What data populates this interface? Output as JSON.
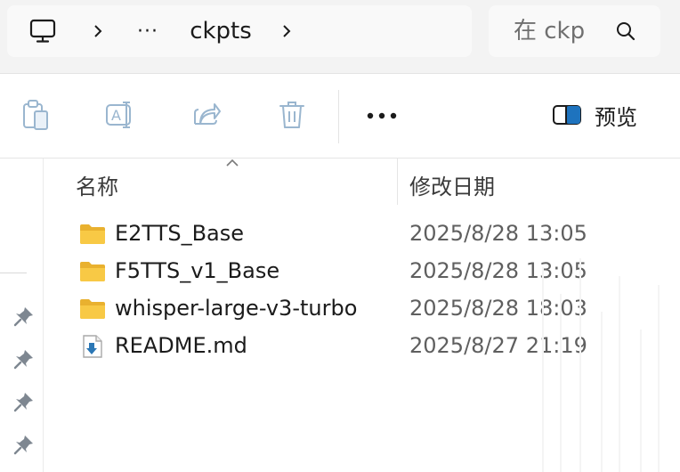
{
  "address_bar": {
    "path": [
      {
        "type": "icon",
        "name": "computer"
      },
      {
        "type": "separator",
        "label": ">"
      },
      {
        "type": "overflow",
        "label": "···"
      },
      {
        "type": "folder",
        "label": "ckpts"
      },
      {
        "type": "separator",
        "label": ">"
      }
    ]
  },
  "search": {
    "placeholder": "在 ckp",
    "icon": "search-icon"
  },
  "toolbar": {
    "buttons": [
      {
        "name": "paste",
        "icon": "clipboard-icon"
      },
      {
        "name": "rename",
        "icon": "rename-icon"
      },
      {
        "name": "share",
        "icon": "share-icon"
      },
      {
        "name": "delete",
        "icon": "trash-icon"
      }
    ],
    "more_label": "•••",
    "preview_label": "预览"
  },
  "columns": {
    "name": "名称",
    "modified": "修改日期"
  },
  "files": [
    {
      "name": "E2TTS_Base",
      "date": "2025/8/28 13:05",
      "type": "folder"
    },
    {
      "name": "F5TTS_v1_Base",
      "date": "2025/8/28 13:05",
      "type": "folder"
    },
    {
      "name": "whisper-large-v3-turbo",
      "date": "2025/8/28 18:03",
      "type": "folder"
    },
    {
      "name": "README.md",
      "date": "2025/8/27 21:19",
      "type": "file"
    }
  ],
  "colors": {
    "folder_yellow": "#f8c945",
    "folder_dark": "#e9b12f",
    "accent_blue": "#1e73be",
    "icon_gray": "#9ab6cf"
  }
}
